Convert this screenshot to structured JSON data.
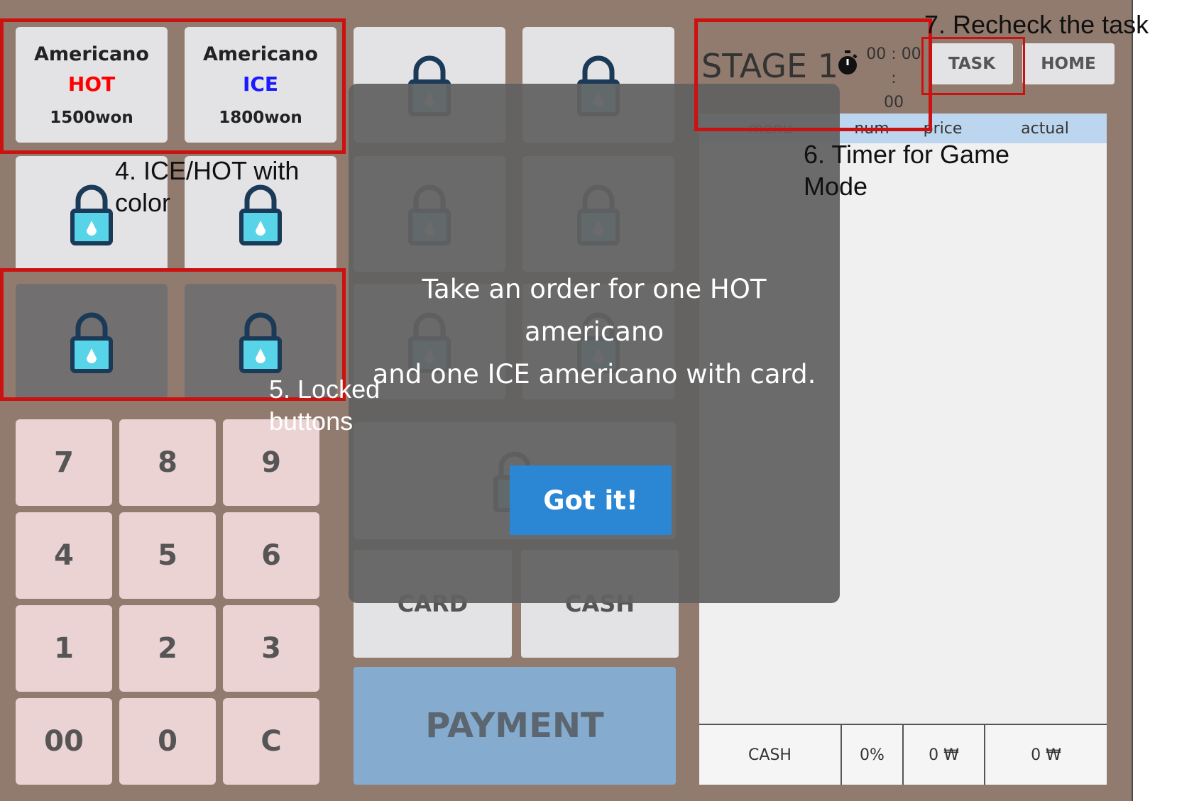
{
  "menu": {
    "hot_item": {
      "name": "Americano",
      "variant": "HOT",
      "variant_color": "#ff0000",
      "price": "1500won"
    },
    "ice_item": {
      "name": "Americano",
      "variant": "ICE",
      "variant_color": "#1a1aff",
      "price": "1800won"
    }
  },
  "lock_icon": {
    "name": "lock-icon",
    "fill_color": "#58d4e8",
    "stroke_color": "#1a3a57"
  },
  "keypad": [
    "7",
    "8",
    "9",
    "4",
    "5",
    "6",
    "1",
    "2",
    "3",
    "00",
    "0",
    "C"
  ],
  "payment_methods": {
    "card": "CARD",
    "cash": "CASH"
  },
  "payment_label": "PAYMENT",
  "header": {
    "stage": "STAGE 1",
    "timer_top": "00 : 00 :",
    "timer_bottom": "00",
    "task_label": "TASK",
    "home_label": "HOME"
  },
  "order_table": {
    "columns": [
      "menu",
      "num",
      "price",
      "actual"
    ],
    "footer": {
      "method": "CASH",
      "discount": "0%",
      "price_total": "0 ₩",
      "actual_total": "0 ₩"
    }
  },
  "modal": {
    "line1": "Take an order for one HOT americano",
    "line2": "and one ICE americano with card.",
    "button": "Got it!"
  },
  "annotations": {
    "a4_line1": "4. ICE/HOT with",
    "a4_line2": "color",
    "a5_line1": "5. Locked",
    "a5_line2": "buttons",
    "a6_line1": "6. Timer for Game",
    "a6_line2": "Mode",
    "a7": "7. Recheck the task"
  },
  "colors": {
    "kiosk_bg": "#917b6e",
    "keypad_key": "#ebd2d3",
    "payment_button": "#85acce",
    "annotation_box": "#cc1111",
    "got_it_button": "#2b87d4"
  }
}
